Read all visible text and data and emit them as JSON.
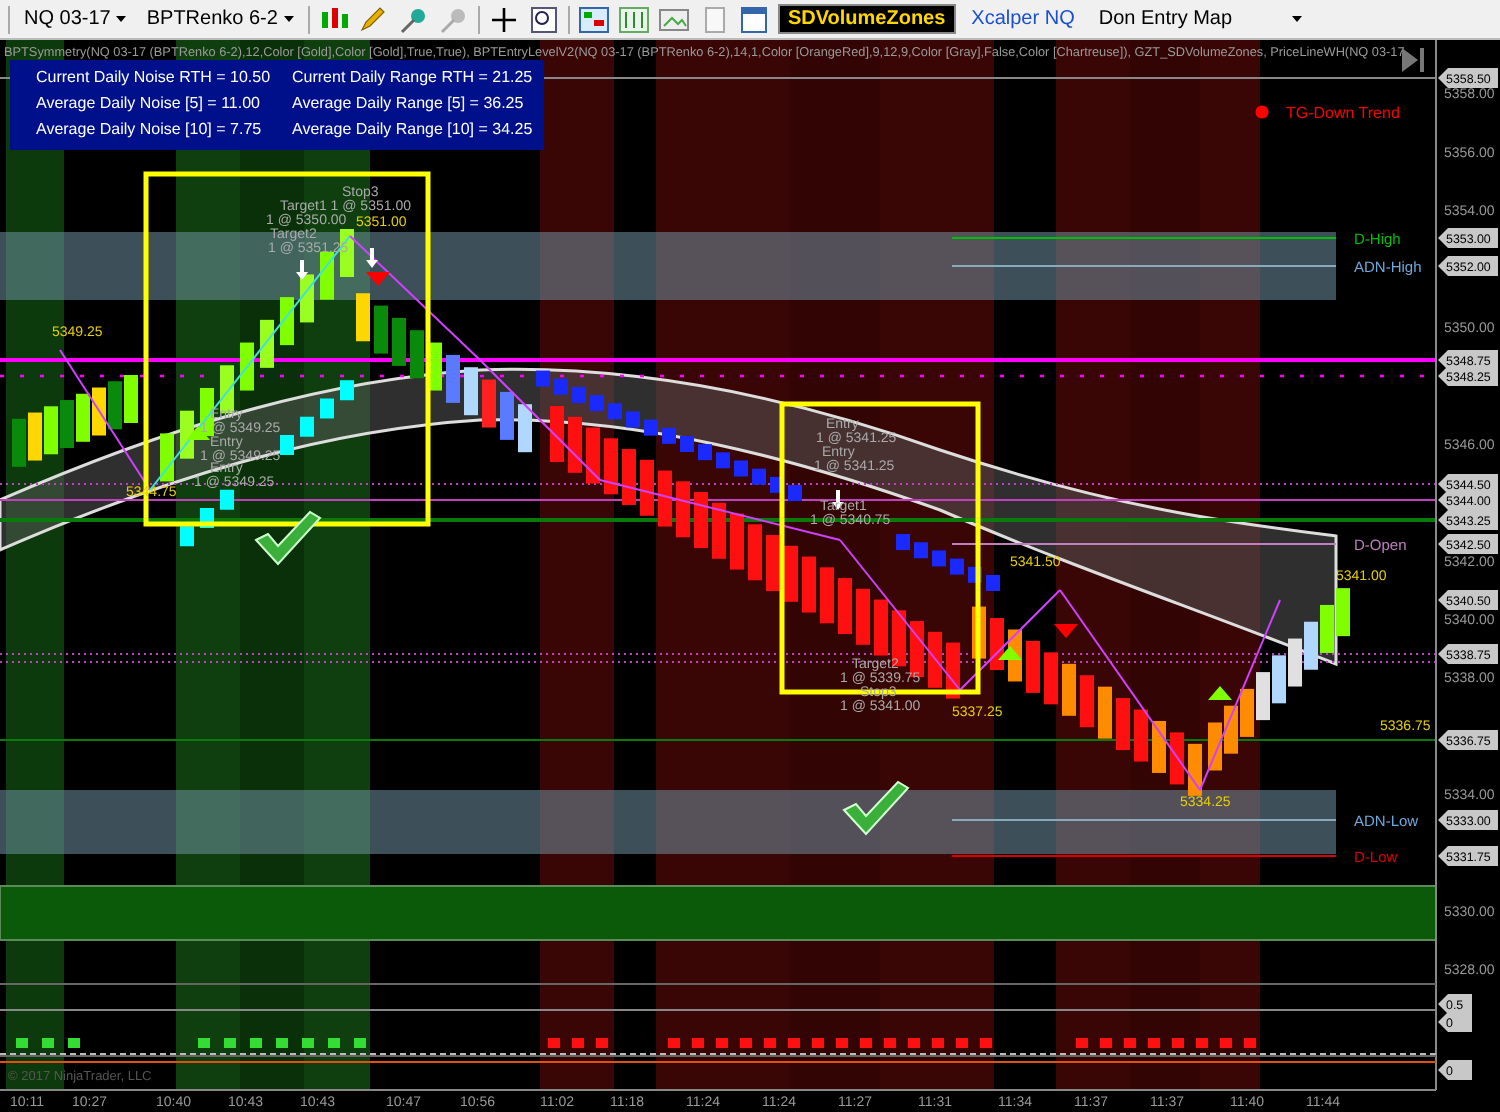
{
  "toolbar": {
    "instrument": "NQ 03-17",
    "bar_type": "BPTRenko 6-2",
    "indicator_button": "SDVolumeZones",
    "template_link": "Xcalper NQ",
    "map_selector": "Don Entry Map"
  },
  "chart": {
    "indicator_header": "BPTSymmetry(NQ 03-17 (BPTRenko 6-2),12,Color [Gold],Color [Gold],True,True), BPTEntryLevelV2(NQ 03-17 (BPTRenko 6-2),14,1,Color [OrangeRed],9,12,9,Color [Gray],False,Color [Chartreuse]), GZT_SDVolumeZones, PriceLineWH(NQ 03-17",
    "stats": [
      "Current Daily Noise RTH = 10.50",
      "Current Daily Range RTH = 21.25",
      "Average Daily Noise [5] = 11.00",
      "Average Daily Range [5] = 36.25",
      "Average Daily Noise [10] = 7.75",
      "Average Daily Range [10] = 34.25"
    ],
    "trend": {
      "label": "TG-Down Trend",
      "color": "#ff0000"
    },
    "levels": [
      {
        "label": "D-High",
        "color": "#00c000"
      },
      {
        "label": "ADN-High",
        "color": "#6fa8dc"
      },
      {
        "label": "D-Open",
        "color": "#c080c0"
      },
      {
        "label": "ADN-Low",
        "color": "#6fa8dc"
      },
      {
        "label": "D-Low",
        "color": "#e00000"
      }
    ],
    "price_ticks": [
      "5358.00",
      "5356.00",
      "5354.00",
      "5350.00",
      "5346.00",
      "5342.00",
      "5340.00",
      "5338.00",
      "5334.00",
      "5330.00",
      "5328.00"
    ],
    "price_flags": [
      "5358.50",
      "5353.00",
      "5352.00",
      "5348.75",
      "5348.25",
      "5344.50",
      "5344.00",
      "5343.25",
      "5342.50",
      "5340.50",
      "5338.75",
      "5336.75",
      "5333.00",
      "5331.75"
    ],
    "lower_flags": [
      "0.5",
      "0",
      "0"
    ],
    "time_labels": [
      "10:11",
      "10:27",
      "10:40",
      "10:43",
      "10:43",
      "10:47",
      "10:56",
      "11:02",
      "11:18",
      "11:24",
      "11:24",
      "11:27",
      "11:31",
      "11:34",
      "11:37",
      "11:37",
      "11:40",
      "11:44"
    ],
    "trade_annotations": [
      "Stop3",
      "Target1 1 @ 5351.00",
      "1 @ 5350.00",
      "Target2",
      "1 @ 5351.25",
      "Entry",
      "1 @ 5349.25",
      "Entry",
      "1 @ 5349.25",
      "Entry",
      "1 @ 5349.25",
      "Entry",
      "1 @ 5341.25",
      "Entry",
      "1 @ 5341.25",
      "Target1",
      "1 @ 5340.75",
      "Target2",
      "1 @ 5339.75",
      "Stop3",
      "1 @ 5341.00"
    ],
    "price_labels": [
      "5349.25",
      "5344.75",
      "5351.00",
      "5341.50",
      "5337.25",
      "5334.25",
      "5341.00",
      "5336.75"
    ],
    "copyright": "© 2017 NinjaTrader, LLC"
  }
}
